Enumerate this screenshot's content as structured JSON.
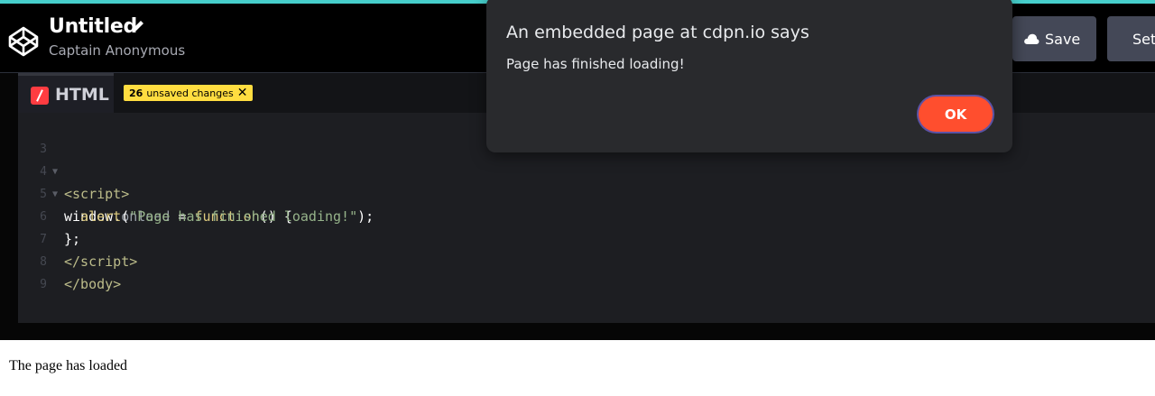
{
  "header": {
    "title": "Untitled",
    "author": "Captain Anonymous",
    "save_label": "Save",
    "settings_label": "Settings"
  },
  "editor": {
    "tab_label": "HTML",
    "unsaved_count": "26",
    "unsaved_text": "unsaved changes",
    "line_numbers": [
      "3",
      "4",
      "5",
      "6",
      "7",
      "8",
      "9"
    ]
  },
  "preview": {
    "text": "The page has loaded"
  },
  "dialog": {
    "title": "An embedded page at cdpn.io says",
    "message": "Page has finished loading!",
    "ok_label": "OK"
  },
  "colors": {
    "accent_teal": "#47cfcc",
    "ok_button": "#ff4e2e",
    "badge": "#ffdd40",
    "html_icon": "#ff3c41"
  }
}
